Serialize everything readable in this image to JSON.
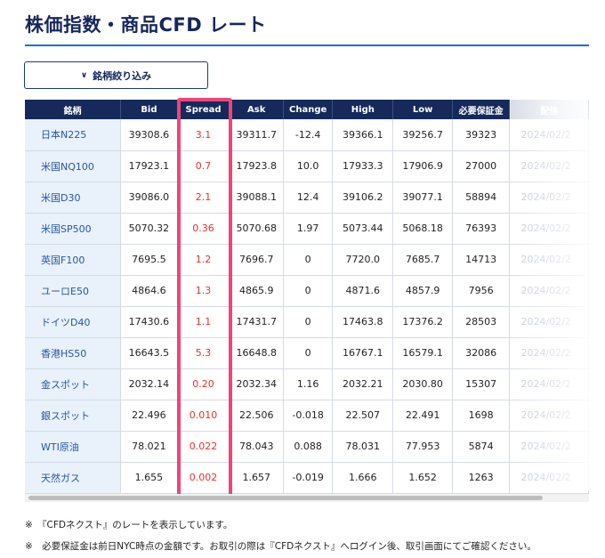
{
  "page": {
    "title": "株価指数・商品CFD レート"
  },
  "filter": {
    "label": "銘柄絞り込み",
    "icon": "chevron-down-icon"
  },
  "table": {
    "headers": [
      "銘柄",
      "Bid",
      "Spread",
      "Ask",
      "Change",
      "High",
      "Low",
      "必要保証金",
      "配信"
    ],
    "rows": [
      {
        "name": "日本N225",
        "bid": "39308.6",
        "spread": "3.1",
        "ask": "39311.7",
        "change": "-12.4",
        "high": "39366.1",
        "low": "39256.7",
        "margin": "39323",
        "date": "2024/02/2"
      },
      {
        "name": "米国NQ100",
        "bid": "17923.1",
        "spread": "0.7",
        "ask": "17923.8",
        "change": "10.0",
        "high": "17933.3",
        "low": "17906.9",
        "margin": "27000",
        "date": "2024/02/2"
      },
      {
        "name": "米国D30",
        "bid": "39086.0",
        "spread": "2.1",
        "ask": "39088.1",
        "change": "12.4",
        "high": "39106.2",
        "low": "39077.1",
        "margin": "58894",
        "date": "2024/02/2"
      },
      {
        "name": "米国SP500",
        "bid": "5070.32",
        "spread": "0.36",
        "ask": "5070.68",
        "change": "1.97",
        "high": "5073.44",
        "low": "5068.18",
        "margin": "76393",
        "date": "2024/02/2"
      },
      {
        "name": "英国F100",
        "bid": "7695.5",
        "spread": "1.2",
        "ask": "7696.7",
        "change": "0",
        "high": "7720.0",
        "low": "7685.7",
        "margin": "14713",
        "date": "2024/02/2"
      },
      {
        "name": "ユーロE50",
        "bid": "4864.6",
        "spread": "1.3",
        "ask": "4865.9",
        "change": "0",
        "high": "4871.6",
        "low": "4857.9",
        "margin": "7956",
        "date": "2024/02/2"
      },
      {
        "name": "ドイツD40",
        "bid": "17430.6",
        "spread": "1.1",
        "ask": "17431.7",
        "change": "0",
        "high": "17463.8",
        "low": "17376.2",
        "margin": "28503",
        "date": "2024/02/2"
      },
      {
        "name": "香港HS50",
        "bid": "16643.5",
        "spread": "5.3",
        "ask": "16648.8",
        "change": "0",
        "high": "16767.1",
        "low": "16579.1",
        "margin": "32086",
        "date": "2024/02/2"
      },
      {
        "name": "金スポット",
        "bid": "2032.14",
        "spread": "0.20",
        "ask": "2032.34",
        "change": "1.16",
        "high": "2032.21",
        "low": "2030.80",
        "margin": "15307",
        "date": "2024/02/2"
      },
      {
        "name": "銀スポット",
        "bid": "22.496",
        "spread": "0.010",
        "ask": "22.506",
        "change": "-0.018",
        "high": "22.507",
        "low": "22.491",
        "margin": "1698",
        "date": "2024/02/2"
      },
      {
        "name": "WTI原油",
        "bid": "78.021",
        "spread": "0.022",
        "ask": "78.043",
        "change": "0.088",
        "high": "78.031",
        "low": "77.953",
        "margin": "5874",
        "date": "2024/02/2"
      },
      {
        "name": "天然ガス",
        "bid": "1.655",
        "spread": "0.002",
        "ask": "1.657",
        "change": "-0.019",
        "high": "1.666",
        "low": "1.652",
        "margin": "1263",
        "date": "2024/02/2"
      }
    ]
  },
  "notes": [
    "※　『CFDネクスト』のレートを表示しています。",
    "※　必要保証金は前日NYC時点の金額です。お取引の際は『CFDネクスト』へログイン後、取引画面にてご確認ください。"
  ],
  "colors": {
    "header_bg": "#152a5b",
    "accent_line": "#1b6fd1",
    "spread_text": "#e4322b",
    "highlight_border": "#f0437a"
  }
}
